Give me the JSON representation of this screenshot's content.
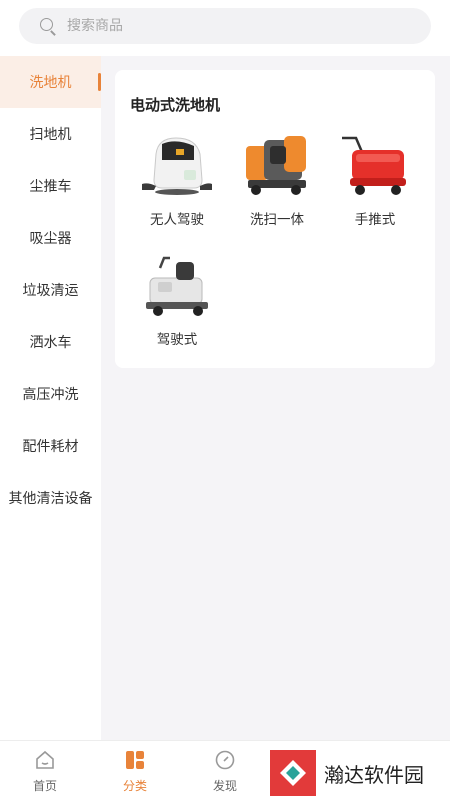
{
  "search": {
    "placeholder": "搜索商品"
  },
  "sidebar": {
    "items": [
      {
        "label": "洗地机",
        "active": true
      },
      {
        "label": "扫地机"
      },
      {
        "label": "尘推车"
      },
      {
        "label": "吸尘器"
      },
      {
        "label": "垃圾清运"
      },
      {
        "label": "洒水车"
      },
      {
        "label": "高压冲洗"
      },
      {
        "label": "配件耗材"
      },
      {
        "label": "其他清洁设备"
      }
    ]
  },
  "main": {
    "section_title": "电动式洗地机",
    "products": [
      {
        "name": "无人驾驶",
        "icon": "autonomous-scrubber-image"
      },
      {
        "name": "洗扫一体",
        "icon": "sweeper-scrubber-image"
      },
      {
        "name": "手推式",
        "icon": "walk-behind-scrubber-image"
      },
      {
        "name": "驾驶式",
        "icon": "ride-on-scrubber-image"
      }
    ]
  },
  "bottom_nav": {
    "items": [
      {
        "label": "首页",
        "icon": "home-icon"
      },
      {
        "label": "分类",
        "icon": "category-icon",
        "active": true
      },
      {
        "label": "发现",
        "icon": "compass-icon"
      }
    ]
  },
  "watermark": {
    "text": "瀚达软件园"
  },
  "colors": {
    "accent": "#e8833a",
    "active_bg": "#fbeee6",
    "page_bg": "#f5f4f7"
  }
}
